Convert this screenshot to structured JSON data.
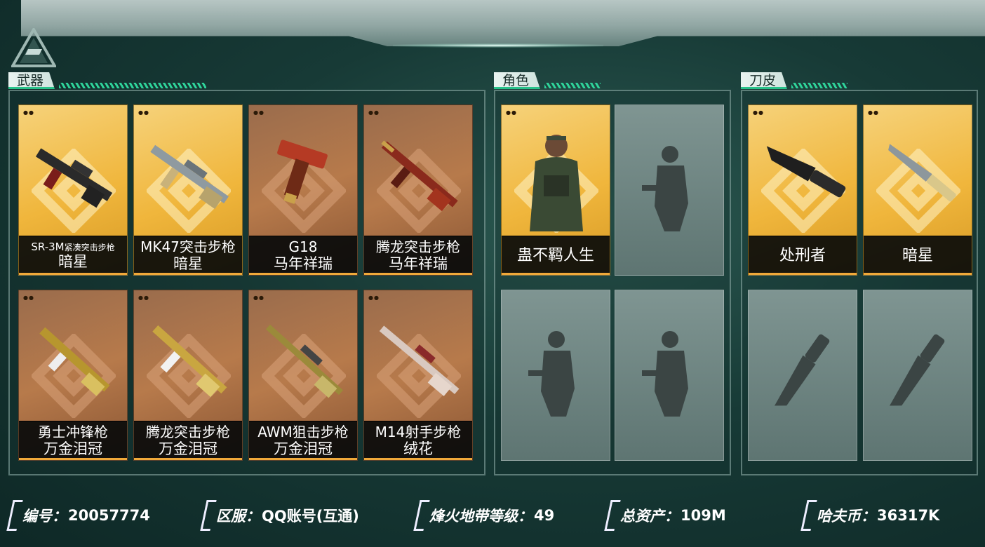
{
  "sections": {
    "weapons_title": "武器",
    "characters_title": "角色",
    "knives_title": "刀皮"
  },
  "weapons": [
    {
      "line1": "SR-3M",
      "line1_sub": "紧凑突击步枪",
      "line2": "暗星",
      "rarity": "gold"
    },
    {
      "line1": "MK47突击步枪",
      "line2": "暗星",
      "rarity": "gold"
    },
    {
      "line1": "G18",
      "line2": "马年祥瑞",
      "rarity": "bronze"
    },
    {
      "line1": "腾龙突击步枪",
      "line2": "马年祥瑞",
      "rarity": "bronze"
    },
    {
      "line1": "勇士冲锋枪",
      "line2": "万金泪冠",
      "rarity": "bronze"
    },
    {
      "line1": "腾龙突击步枪",
      "line2": "万金泪冠",
      "rarity": "bronze"
    },
    {
      "line1": "AWM狙击步枪",
      "line2": "万金泪冠",
      "rarity": "bronze"
    },
    {
      "line1": "M14射手步枪",
      "line2": "绒花",
      "rarity": "bronze"
    }
  ],
  "characters": [
    {
      "name": "蛊不羁人生",
      "rarity": "gold"
    }
  ],
  "knives": [
    {
      "name": "处刑者",
      "rarity": "gold"
    },
    {
      "name": "暗星",
      "rarity": "gold"
    }
  ],
  "footer": {
    "id_label": "编号：",
    "id_value": "20057774",
    "server_label": "区服：",
    "server_value": "QQ账号(互通)",
    "level_label": "烽火地带等级：",
    "level_value": "49",
    "assets_label": "总资产：",
    "assets_value": "109M",
    "coins_label": "哈夫币：",
    "coins_value": "36317K"
  },
  "colors": {
    "accent": "#2fd39a",
    "gold_card": "#f0b63c",
    "bronze_card": "#b77a4b"
  }
}
